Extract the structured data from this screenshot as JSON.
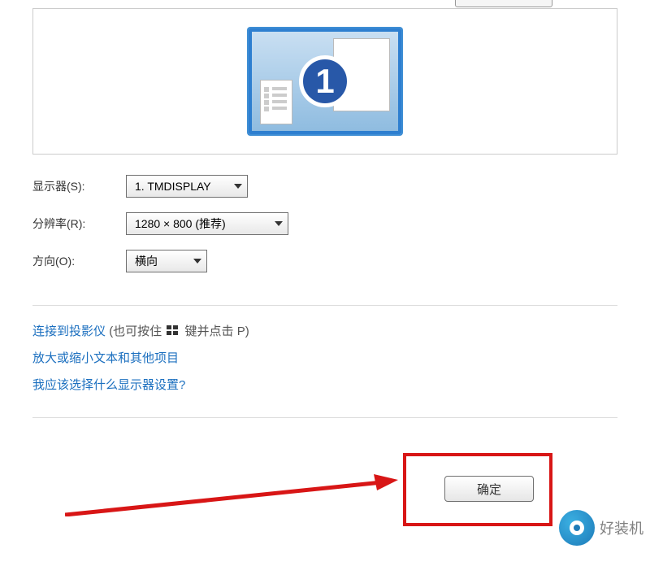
{
  "monitor_number": "1",
  "labels": {
    "display": "显示器(S):",
    "resolution": "分辨率(R):",
    "orientation": "方向(O):"
  },
  "values": {
    "display": "1. TMDISPLAY",
    "resolution": "1280 × 800 (推荐)",
    "orientation": "横向"
  },
  "links": {
    "projector_prefix": "连接到投影仪",
    "projector_hint_before": " (也可按住 ",
    "projector_hint_after": " 键并点击 P)",
    "zoom_text": "放大或缩小文本和其他项目",
    "help_text": "我应该选择什么显示器设置?"
  },
  "buttons": {
    "ok": "确定"
  },
  "watermark": "好装机"
}
